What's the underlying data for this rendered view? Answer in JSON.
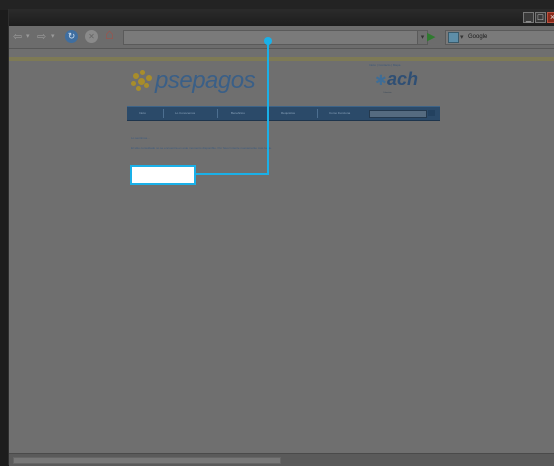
{
  "browser": {
    "search_placeholder": "Google",
    "nav_back": "⇦",
    "nav_forward": "⇨",
    "nav_dropdown": "▾",
    "stop_glyph": "✕",
    "refresh_glyph": "↻",
    "home_glyph": "⌂",
    "go_glyph": "▶",
    "window_min": "_",
    "window_max": "□",
    "window_close": "×"
  },
  "page": {
    "top_link": "Inicio | Contacto | Mapa",
    "logo": "psepagos",
    "partner_logo": "ach",
    "partner_subtitle": "Colombia",
    "nav": {
      "items": [
        "Inicio",
        "Lo Conocemos",
        "Beneficios",
        "Requisitos",
        "Como Funciona"
      ]
    },
    "message_title": "Lo sentimos...",
    "message_body": "El sitio consultado no se encuentra en este momento disponible. Por favor intente nuevamente mas tarde."
  },
  "colors": {
    "highlight_border": "#1ab0e8",
    "nav_bar": "#2b4a69",
    "logo_blue": "#3a5f87",
    "logo_gold": "#a88d2a"
  }
}
